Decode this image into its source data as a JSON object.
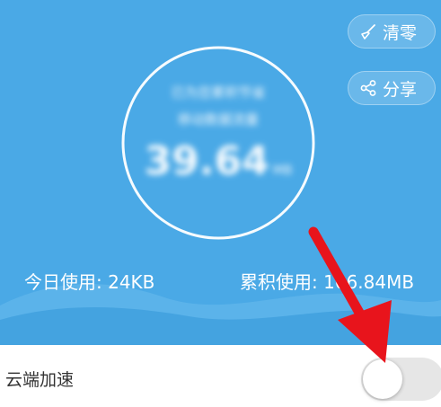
{
  "colors": {
    "hero_background": "#4aa9e6",
    "wave_light": "#5db4ea",
    "wave_dark": "#3f9fdd",
    "toggle_off": "#e6e6e6",
    "annotation_arrow": "#e8141c"
  },
  "header": {
    "clear_button": {
      "label": "清零",
      "icon": "broom-icon"
    },
    "share_button": {
      "label": "分享",
      "icon": "share-icon"
    }
  },
  "gauge": {
    "line1": "已为您累积节省",
    "line2": "移动数据流量",
    "value": "39.64",
    "unit": "MB"
  },
  "stats": {
    "today": "今日使用: 24KB",
    "total": "累积使用: 106.84MB"
  },
  "settings": {
    "cloud_acceleration": {
      "label": "云端加速",
      "enabled": false
    }
  }
}
